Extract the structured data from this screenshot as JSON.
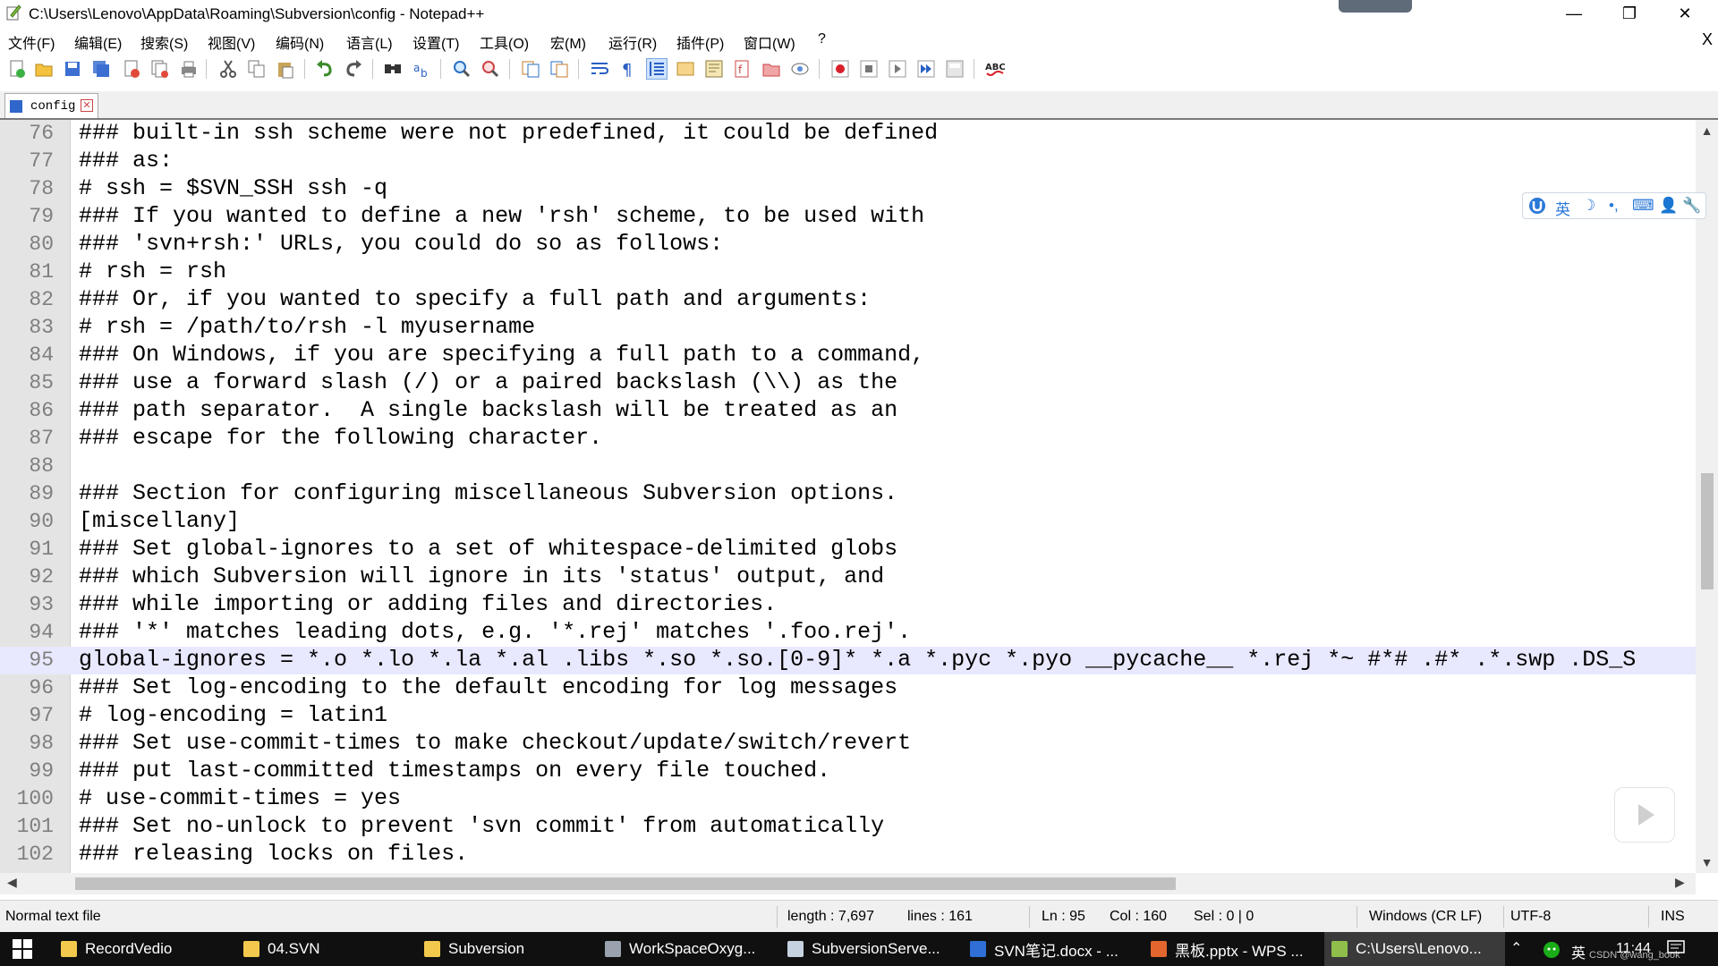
{
  "window": {
    "title": "C:\\Users\\Lenovo\\AppData\\Roaming\\Subversion\\config - Notepad++",
    "minimize": "—",
    "maximize": "❐",
    "close": "✕"
  },
  "menu": {
    "items": [
      "文件(F)",
      "编辑(E)",
      "搜索(S)",
      "视图(V)",
      "编码(N)",
      "语言(L)",
      "设置(T)",
      "工具(O)",
      "宏(M)",
      "运行(R)",
      "插件(P)",
      "窗口(W)",
      "?"
    ],
    "close_doc": "X"
  },
  "tabs": [
    {
      "label": "config",
      "close": "✕"
    }
  ],
  "editor": {
    "current_line": 95,
    "lines": [
      {
        "n": "76",
        "text": "### built-in ssh scheme were not predefined, it could be defined"
      },
      {
        "n": "77",
        "text": "### as:"
      },
      {
        "n": "78",
        "text": "# ssh = $SVN_SSH ssh -q"
      },
      {
        "n": "79",
        "text": "### If you wanted to define a new 'rsh' scheme, to be used with"
      },
      {
        "n": "80",
        "text": "### 'svn+rsh:' URLs, you could do so as follows:"
      },
      {
        "n": "81",
        "text": "# rsh = rsh"
      },
      {
        "n": "82",
        "text": "### Or, if you wanted to specify a full path and arguments:"
      },
      {
        "n": "83",
        "text": "# rsh = /path/to/rsh -l myusername"
      },
      {
        "n": "84",
        "text": "### On Windows, if you are specifying a full path to a command,"
      },
      {
        "n": "85",
        "text": "### use a forward slash (/) or a paired backslash (\\\\) as the"
      },
      {
        "n": "86",
        "text": "### path separator.  A single backslash will be treated as an"
      },
      {
        "n": "87",
        "text": "### escape for the following character."
      },
      {
        "n": "88",
        "text": ""
      },
      {
        "n": "89",
        "text": "### Section for configuring miscellaneous Subversion options."
      },
      {
        "n": "90",
        "text": "[miscellany]"
      },
      {
        "n": "91",
        "text": "### Set global-ignores to a set of whitespace-delimited globs"
      },
      {
        "n": "92",
        "text": "### which Subversion will ignore in its 'status' output, and"
      },
      {
        "n": "93",
        "text": "### while importing or adding files and directories."
      },
      {
        "n": "94",
        "text": "### '*' matches leading dots, e.g. '*.rej' matches '.foo.rej'."
      },
      {
        "n": "95",
        "text": "global-ignores = *.o *.lo *.la *.al .libs *.so *.so.[0-9]* *.a *.pyc *.pyo __pycache__ *.rej *~ #*# .#* .*.swp .DS_S"
      },
      {
        "n": "96",
        "text": "### Set log-encoding to the default encoding for log messages"
      },
      {
        "n": "97",
        "text": "# log-encoding = latin1"
      },
      {
        "n": "98",
        "text": "### Set use-commit-times to make checkout/update/switch/revert"
      },
      {
        "n": "99",
        "text": "### put last-committed timestamps on every file touched."
      },
      {
        "n": "100",
        "text": "# use-commit-times = yes"
      },
      {
        "n": "101",
        "text": "### Set no-unlock to prevent 'svn commit' from automatically"
      },
      {
        "n": "102",
        "text": "### releasing locks on files."
      }
    ]
  },
  "ime": {
    "lang": "英",
    "moon": "☽",
    "punct": "•,",
    "keyboard": "⌨",
    "user": "👤",
    "tool": "🔧"
  },
  "status": {
    "file_type": "Normal text file",
    "length": "length : 7,697",
    "lines": "lines : 161",
    "ln": "Ln : 95",
    "col": "Col : 160",
    "sel": "Sel : 0 | 0",
    "eol": "Windows (CR LF)",
    "encoding": "UTF-8",
    "mode": "INS"
  },
  "taskbar": {
    "items": [
      {
        "label": "RecordVedio",
        "icon": "folder-icon",
        "color": "#f2c94c"
      },
      {
        "label": "04.SVN",
        "icon": "folder-icon",
        "color": "#f2c94c"
      },
      {
        "label": "Subversion",
        "icon": "folder-icon",
        "color": "#f2c94c"
      },
      {
        "label": "WorkSpaceOxyg...",
        "icon": "gear-icon",
        "color": "#9aa3ad"
      },
      {
        "label": "SubversionServe...",
        "icon": "server-icon",
        "color": "#c6d2e0"
      },
      {
        "label": "SVN笔记.docx - ...",
        "icon": "wps-writer-icon",
        "color": "#2f6fd6"
      },
      {
        "label": "黑板.pptx - WPS ...",
        "icon": "wps-ppt-icon",
        "color": "#e2662d"
      },
      {
        "label": "C:\\Users\\Lenovo...",
        "icon": "notepadpp-icon",
        "color": "#8fbf4a"
      }
    ],
    "tray_ime": "英",
    "clock": "11:44",
    "watermark": "CSDN @wang_book"
  }
}
